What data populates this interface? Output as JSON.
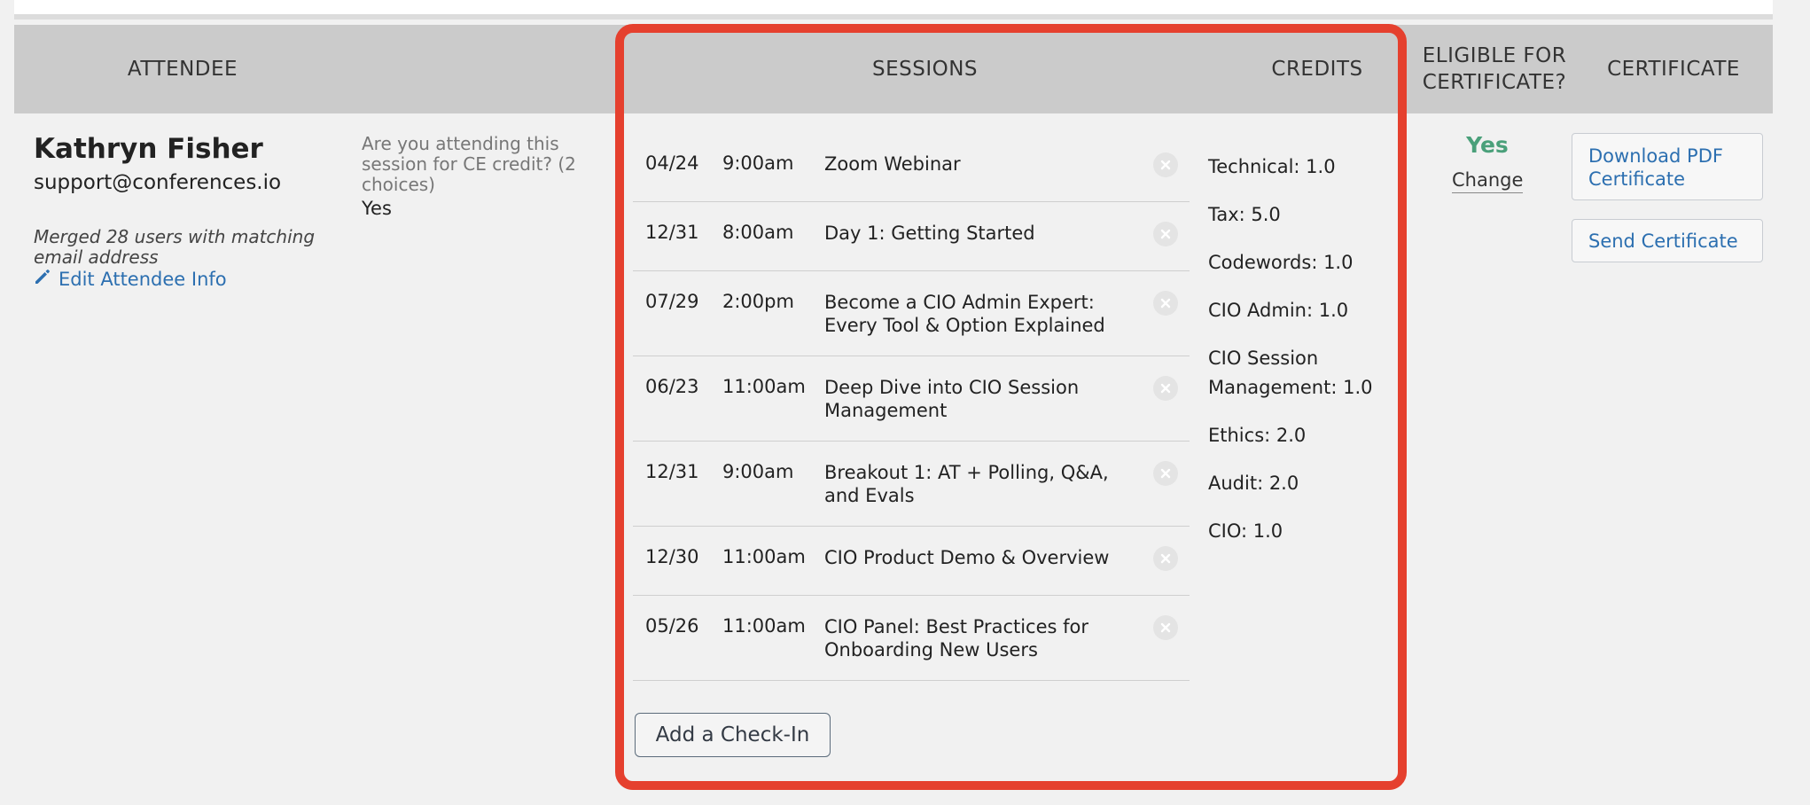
{
  "header": {
    "attendee": "ATTENDEE",
    "sessions": "SESSIONS",
    "credits": "CREDITS",
    "eligible": "ELIGIBLE FOR CERTIFICATE?",
    "certificate": "CERTIFICATE"
  },
  "attendee": {
    "name": "Kathryn Fisher",
    "email": "support@conferences.io",
    "merged_note": "Merged 28 users with matching email address",
    "edit_label": "Edit Attendee Info"
  },
  "ce_question": {
    "question": "Are you attending this session for CE credit? (2 choices)",
    "answer": "Yes"
  },
  "sessions": [
    {
      "date": "04/24",
      "time": "9:00am",
      "title": "Zoom Webinar"
    },
    {
      "date": "12/31",
      "time": "8:00am",
      "title": "Day 1: Getting Started"
    },
    {
      "date": "07/29",
      "time": "2:00pm",
      "title": "Become a CIO Admin Expert: Every Tool & Option Explained"
    },
    {
      "date": "06/23",
      "time": "11:00am",
      "title": "Deep Dive into CIO Session Management"
    },
    {
      "date": "12/31",
      "time": "9:00am",
      "title": "Breakout 1: AT + Polling, Q&A, and Evals"
    },
    {
      "date": "12/30",
      "time": "11:00am",
      "title": "CIO Product Demo & Overview"
    },
    {
      "date": "05/26",
      "time": "11:00am",
      "title": "CIO Panel: Best Practices for Onboarding New Users"
    }
  ],
  "add_checkin_label": "Add a Check-In",
  "credits": [
    "Technical: 1.0",
    "Tax: 5.0",
    "Codewords: 1.0",
    "CIO Admin: 1.0",
    "CIO Session Management: 1.0",
    "Ethics: 2.0",
    "Audit: 2.0",
    "CIO: 1.0"
  ],
  "eligibility": {
    "value": "Yes",
    "change_label": "Change"
  },
  "certificate": {
    "download_label": "Download PDF Certificate",
    "send_label": "Send Certificate"
  },
  "icons": {
    "remove": "remove-circle-icon",
    "edit": "pencil-icon"
  },
  "colors": {
    "highlight": "#e5402e",
    "eligible_yes": "#4aa07a",
    "link": "#2c6fb0",
    "header_bg": "#cbcbcb"
  }
}
